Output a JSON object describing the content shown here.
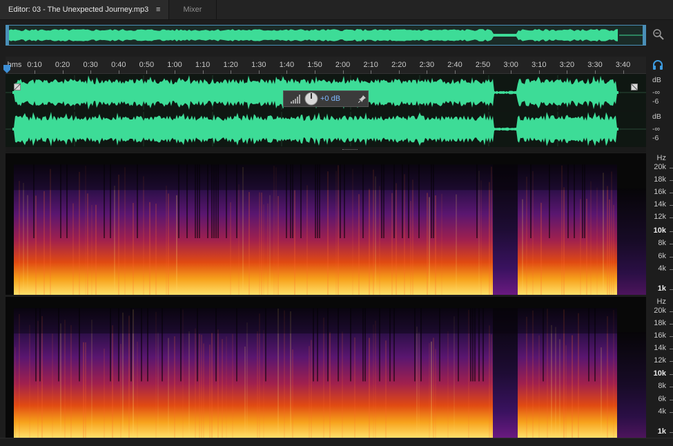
{
  "tabs": {
    "editor_label": "Editor: 03 - The Unexpected Journey.mp3",
    "menu_glyph": "≡",
    "mixer_label": "Mixer"
  },
  "ruler": {
    "unit": "hms",
    "labels": [
      "0:10",
      "0:20",
      "0:30",
      "0:40",
      "0:50",
      "1:00",
      "1:10",
      "1:20",
      "1:30",
      "1:40",
      "1:50",
      "2:00",
      "2:10",
      "2:20",
      "2:30",
      "2:40",
      "2:50",
      "3:00",
      "3:10",
      "3:20",
      "3:30",
      "3:40"
    ]
  },
  "waveform": {
    "color": "#3ddc97",
    "scale": {
      "db_label": "dB",
      "inf_label": "-∞",
      "neg6_label": "-6"
    }
  },
  "hud": {
    "volume": "+0 dB"
  },
  "spectral": {
    "hz_label": "Hz",
    "freq_labels": [
      "20k",
      "18k",
      "16k",
      "14k",
      "12k",
      "10k",
      "8k",
      "6k",
      "4k",
      "1k"
    ]
  },
  "icons": {
    "zoom": "zoom-icon",
    "headphones": "headphone-icon",
    "pin": "pin-icon",
    "knob": "volume-knob-icon"
  }
}
